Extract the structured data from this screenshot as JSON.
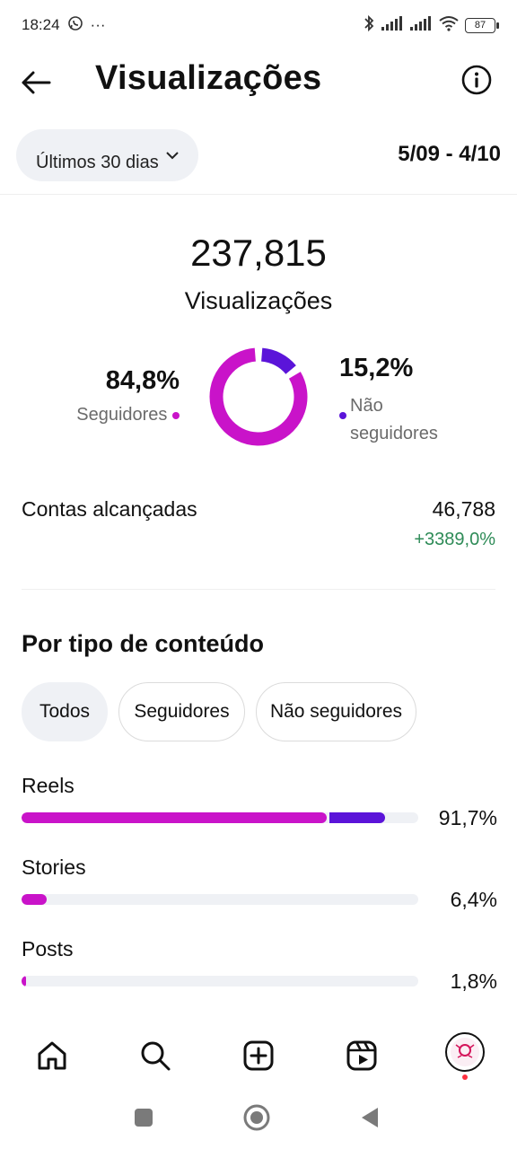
{
  "status_bar": {
    "time": "18:24",
    "more": "···",
    "battery": "87"
  },
  "header": {
    "title": "Visualizações"
  },
  "filters": {
    "range_label": "Últimos 30 dias",
    "date_range": "5/09 - 4/10"
  },
  "summary": {
    "total": "237,815",
    "total_label": "Visualizações",
    "followers_pct": "84,8%",
    "followers_label": "Seguidores",
    "non_followers_pct": "15,2%",
    "non_followers_label_line1": "Não",
    "non_followers_label_line2": "seguidores",
    "followers_share": 0.848,
    "non_followers_share": 0.152
  },
  "reach": {
    "label": "Contas alcançadas",
    "value": "46,788",
    "change": "+3389,0%"
  },
  "content_type": {
    "title": "Por tipo de conteúdo",
    "tabs": [
      "Todos",
      "Seguidores",
      "Não seguidores"
    ],
    "active_tab": "Todos",
    "rows": [
      {
        "label": "Reels",
        "pct": "91,7%",
        "total_share": 0.917,
        "followers_share": 0.77
      },
      {
        "label": "Stories",
        "pct": "6,4%",
        "total_share": 0.064,
        "followers_share": 0.064
      },
      {
        "label": "Posts",
        "pct": "1,8%",
        "total_share": 0.018,
        "followers_share": 0.012
      }
    ]
  },
  "colors": {
    "followers": "#c913c9",
    "non_followers": "#5b14d9",
    "positive": "#2e8b57",
    "chip_bg": "#eff1f5"
  },
  "icons": {
    "nav": [
      "home-icon",
      "search-icon",
      "create-icon",
      "reels-icon",
      "profile-avatar"
    ],
    "system": [
      "recents-icon",
      "home-circle-icon",
      "back-triangle-icon"
    ]
  }
}
